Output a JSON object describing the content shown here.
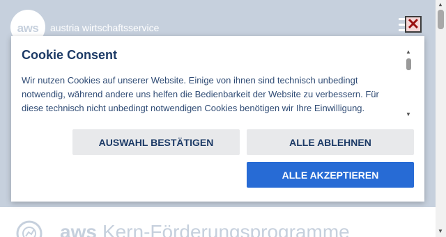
{
  "header": {
    "logo_text": "aws",
    "brand_name": "austria wirtschaftsservice"
  },
  "program": {
    "prefix": "aws",
    "title": "Kern-Förderungsprogramme"
  },
  "cookie_dialog": {
    "title": "Cookie Consent",
    "text": "Wir nutzen Cookies auf unserer Website. Einige von ihnen sind technisch unbedingt notwendig, während andere uns helfen die Bedienbarkeit der Website zu verbessern. Für diese technisch nicht unbedingt notwendigen Cookies benötigen wir Ihre Einwilligung.",
    "buttons": {
      "confirm_selection": "AUSWAHL BESTÄTIGEN",
      "reject_all": "ALLE ABLEHNEN",
      "accept_all": "ALLE AKZEPTIEREN"
    }
  },
  "icons": {
    "close": "close-icon",
    "menu": "hamburger-menu-icon",
    "program": "gear-chart-icon"
  },
  "colors": {
    "header_bg": "#c6d0dd",
    "title_color": "#1c3a66",
    "primary_button": "#276bd5",
    "secondary_button": "#e8e9eb"
  }
}
